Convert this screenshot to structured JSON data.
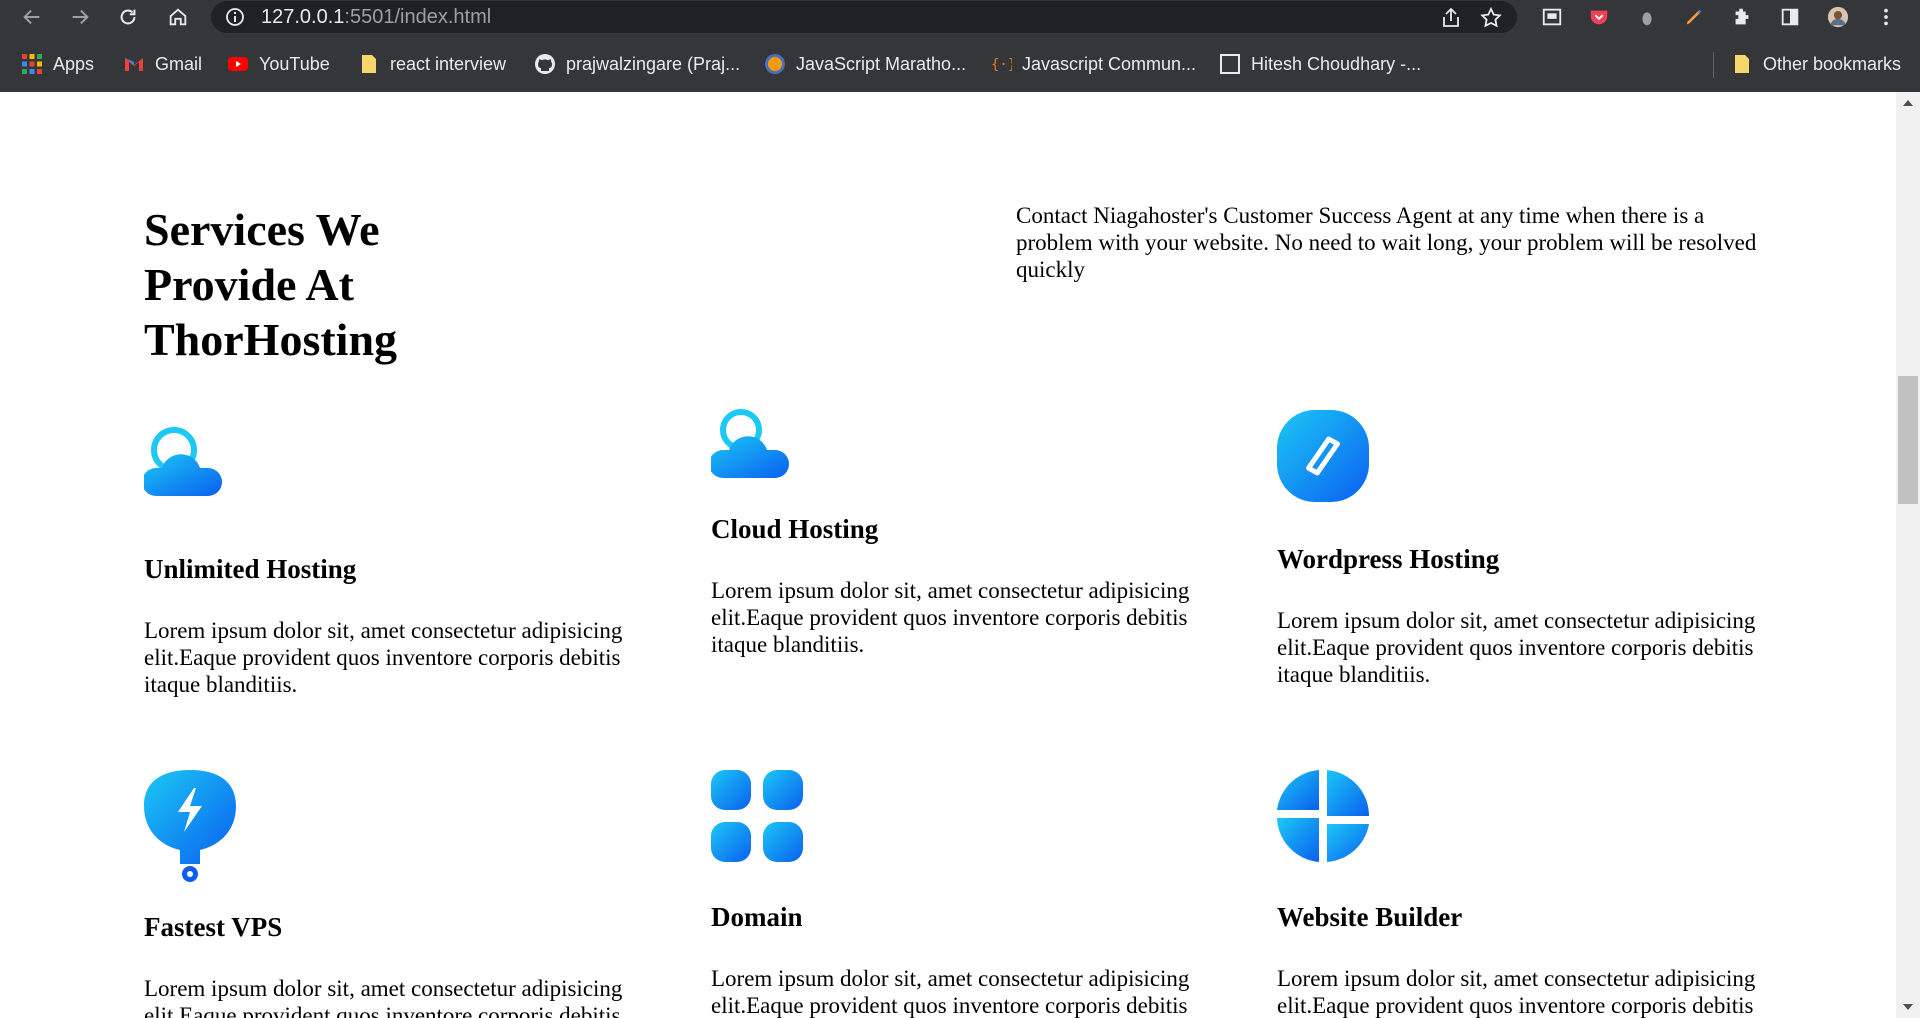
{
  "browser": {
    "url_host": "127.0.0.1",
    "url_path": ":5501/index.html",
    "bookmarks": [
      {
        "label": "Apps",
        "icon": "apps-grid-icon"
      },
      {
        "label": "Gmail",
        "icon": "gmail-icon"
      },
      {
        "label": "YouTube",
        "icon": "youtube-icon"
      },
      {
        "label": "react interview",
        "icon": "folder-icon"
      },
      {
        "label": "prajwalzingare (Praj...",
        "icon": "github-icon"
      },
      {
        "label": "JavaScript Maratho...",
        "icon": "marathon-icon"
      },
      {
        "label": "Javascript Commun...",
        "icon": "code-braces-icon"
      },
      {
        "label": "Hitesh Choudhary -...",
        "icon": "page-icon"
      }
    ],
    "other_bookmarks": "Other bookmarks"
  },
  "page": {
    "title": "Services We Provide At ThorHosting",
    "description": "Contact Niagahoster's Customer Success Agent at any time when there is a problem with your website. No need to wait long, your problem will be resolved quickly",
    "services": [
      {
        "title": "Unlimited Hosting",
        "text": "Lorem ipsum dolor sit, amet consectetur adipisicing elit.Eaque provident quos inventore corporis debitis itaque blanditiis.",
        "icon": "cloud-icon"
      },
      {
        "title": "Cloud Hosting",
        "text": "Lorem ipsum dolor sit, amet consectetur adipisicing elit.Eaque provident quos inventore corporis debitis itaque blanditiis.",
        "icon": "cloud-icon"
      },
      {
        "title": "Wordpress Hosting",
        "text": "Lorem ipsum dolor sit, amet consectetur adipisicing elit.Eaque provident quos inventore corporis debitis itaque blanditiis.",
        "icon": "wordpress-icon"
      },
      {
        "title": "Fastest VPS",
        "text": "Lorem ipsum dolor sit, amet consectetur adipisicing elit.Eaque provident quos inventore corporis debitis itaque blanditiis.",
        "icon": "lightning-pin-icon"
      },
      {
        "title": "Domain",
        "text": "Lorem ipsum dolor sit, amet consectetur adipisicing elit.Eaque provident quos inventore corporis debitis itaque blanditiis.",
        "icon": "grid-squares-icon"
      },
      {
        "title": "Website Builder",
        "text": "Lorem ipsum dolor sit, amet consectetur adipisicing elit.Eaque provident quos inventore corporis debitis itaque blanditiis.",
        "icon": "layout-pie-icon"
      }
    ]
  },
  "colors": {
    "chrome_bg": "#35363a",
    "omnibox_bg": "#202124",
    "icon_gradient_start": "#1cc8f5",
    "icon_gradient_end": "#0a5ff0"
  }
}
